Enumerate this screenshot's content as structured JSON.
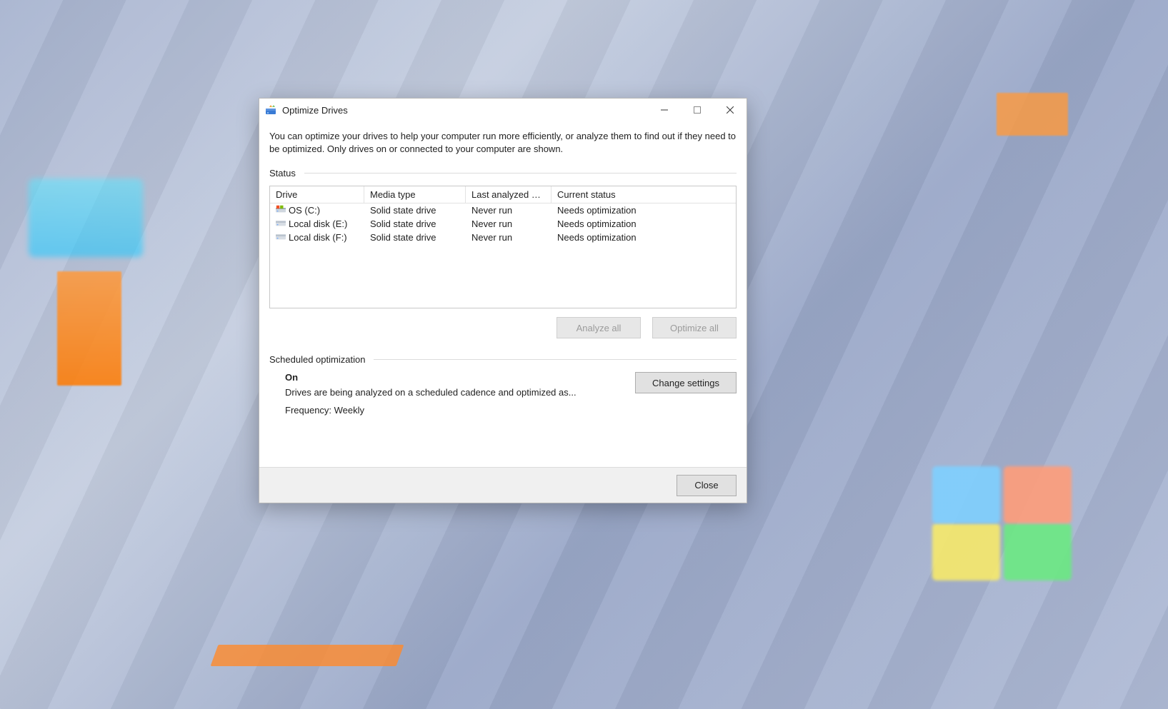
{
  "window": {
    "title": "Optimize Drives",
    "intro": "You can optimize your drives to help your computer run more efficiently, or analyze them to find out if they need to be optimized. Only drives on or connected to your computer are shown."
  },
  "status": {
    "group_label": "Status",
    "columns": {
      "drive": "Drive",
      "media": "Media type",
      "last": "Last analyzed or ...",
      "current": "Current status"
    },
    "rows": [
      {
        "icon": "os",
        "drive": "OS (C:)",
        "media": "Solid state drive",
        "last": "Never run",
        "current": "Needs optimization"
      },
      {
        "icon": "local",
        "drive": "Local disk (E:)",
        "media": "Solid state drive",
        "last": "Never run",
        "current": "Needs optimization"
      },
      {
        "icon": "local",
        "drive": "Local disk (F:)",
        "media": "Solid state drive",
        "last": "Never run",
        "current": "Needs optimization"
      }
    ],
    "buttons": {
      "analyze": "Analyze all",
      "optimize": "Optimize all"
    }
  },
  "schedule": {
    "group_label": "Scheduled optimization",
    "state": "On",
    "description": "Drives are being analyzed on a scheduled cadence and optimized as...",
    "frequency": "Frequency: Weekly",
    "change_button": "Change settings"
  },
  "footer": {
    "close": "Close"
  }
}
